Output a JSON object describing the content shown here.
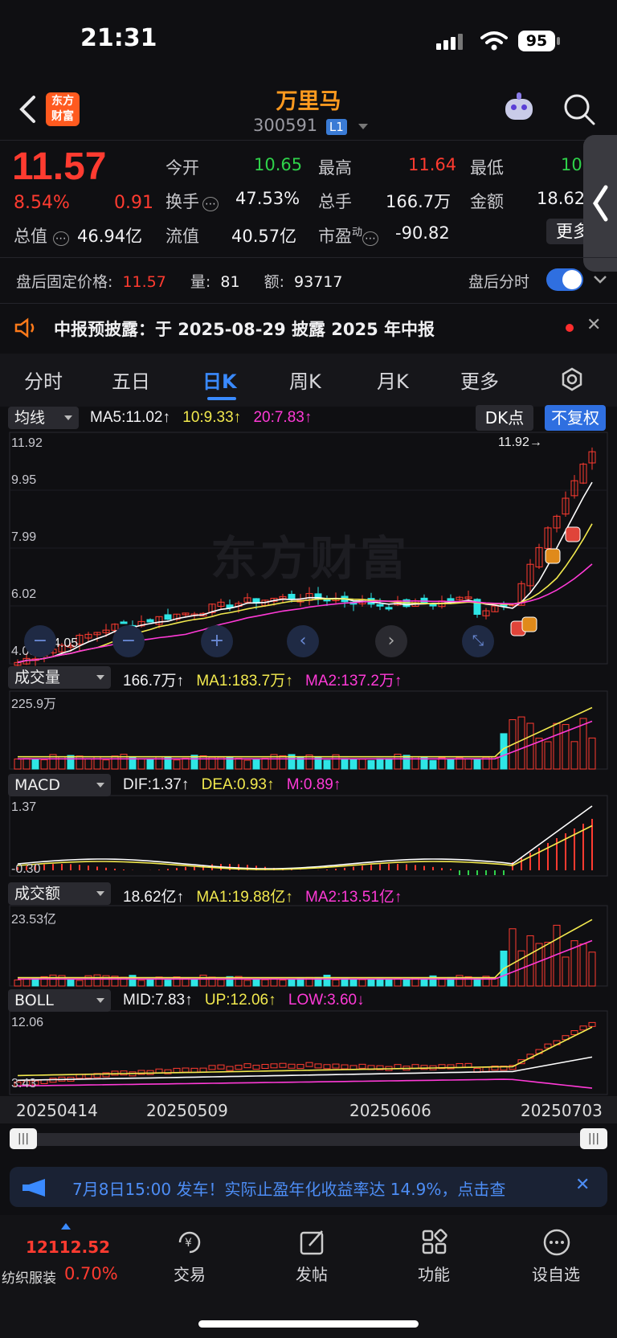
{
  "status_bar": {
    "time": "21:31",
    "battery": "95"
  },
  "header": {
    "name": "万里马",
    "code": "300591",
    "level": "L1",
    "logo_line1": "东方",
    "logo_line2": "财富"
  },
  "quote": {
    "price": "11.57",
    "change_pct": "8.54%",
    "change": "0.91",
    "open_label": "今开",
    "open": "10.65",
    "high_label": "最高",
    "high": "11.64",
    "low_label": "最低",
    "low": "10",
    "turnover_label": "换手",
    "turnover": "47.53%",
    "volume_label": "总手",
    "volume": "166.7万",
    "amount_label": "金额",
    "amount": "18.62",
    "mktcap_label": "总值",
    "mktcap": "46.94亿",
    "float_label": "流值",
    "float": "40.57亿",
    "pe_label": "市盈",
    "pe_sup": "动",
    "pe": "-90.82",
    "more": "更多"
  },
  "after_hours": {
    "label": "盘后固定价格:",
    "price": "11.57",
    "vol_label": "量:",
    "vol": "81",
    "amt_label": "额:",
    "amt": "93717",
    "toggle_label": "盘后分时"
  },
  "notice": {
    "text": "中报预披露：于 2025-08-29 披露 2025 年中报"
  },
  "tabs": [
    "分时",
    "五日",
    "日K",
    "周K",
    "月K",
    "更多"
  ],
  "kline": {
    "ma_select": "均线",
    "ma5": "MA5:11.02↑",
    "ma10": "10:9.33↑",
    "ma20": "20:7.83↑",
    "dk": "DK点",
    "adjust": "不复权",
    "yticks": [
      "11.92",
      "9.95",
      "7.99",
      "6.02",
      "4.05"
    ],
    "high_mark": "11.92→",
    "low_mark": "←4.05",
    "watermark": "东方财富"
  },
  "volume": {
    "select": "成交量",
    "value": "166.7万↑",
    "ma1": "MA1:183.7万↑",
    "ma2": "MA2:137.2万↑",
    "ytick": "225.9万"
  },
  "macd": {
    "select": "MACD",
    "dif": "DIF:1.37↑",
    "dea": "DEA:0.93↑",
    "m": "M:0.89↑",
    "ytop": "1.37",
    "ybot": "-0.30"
  },
  "amount": {
    "select": "成交额",
    "value": "18.62亿↑",
    "ma1": "MA1:19.88亿↑",
    "ma2": "MA2:13.51亿↑",
    "ytick": "23.53亿"
  },
  "boll": {
    "select": "BOLL",
    "mid": "MID:7.83↑",
    "up": "UP:12.06↑",
    "low": "LOW:3.60↓",
    "ytop": "12.06",
    "ybot": "3.43"
  },
  "dates": [
    "20250414",
    "20250509",
    "20250606",
    "20250703"
  ],
  "banner": {
    "text": "7月8日15:00 发车！实际止盈年化收益率达 14.9%，点击查"
  },
  "bottom": {
    "index_value": "12112.52",
    "index_name": "纺织服装",
    "index_change": "0.70%",
    "trade": "交易",
    "post": "发帖",
    "func": "功能",
    "watch": "设自选"
  },
  "colors": {
    "up": "#ff3b30",
    "down": "#2ee6e6",
    "ma5": "#ffffff",
    "ma10": "#f2e94e",
    "ma20": "#ff3ad7",
    "accent": "#3a7bd5"
  }
}
